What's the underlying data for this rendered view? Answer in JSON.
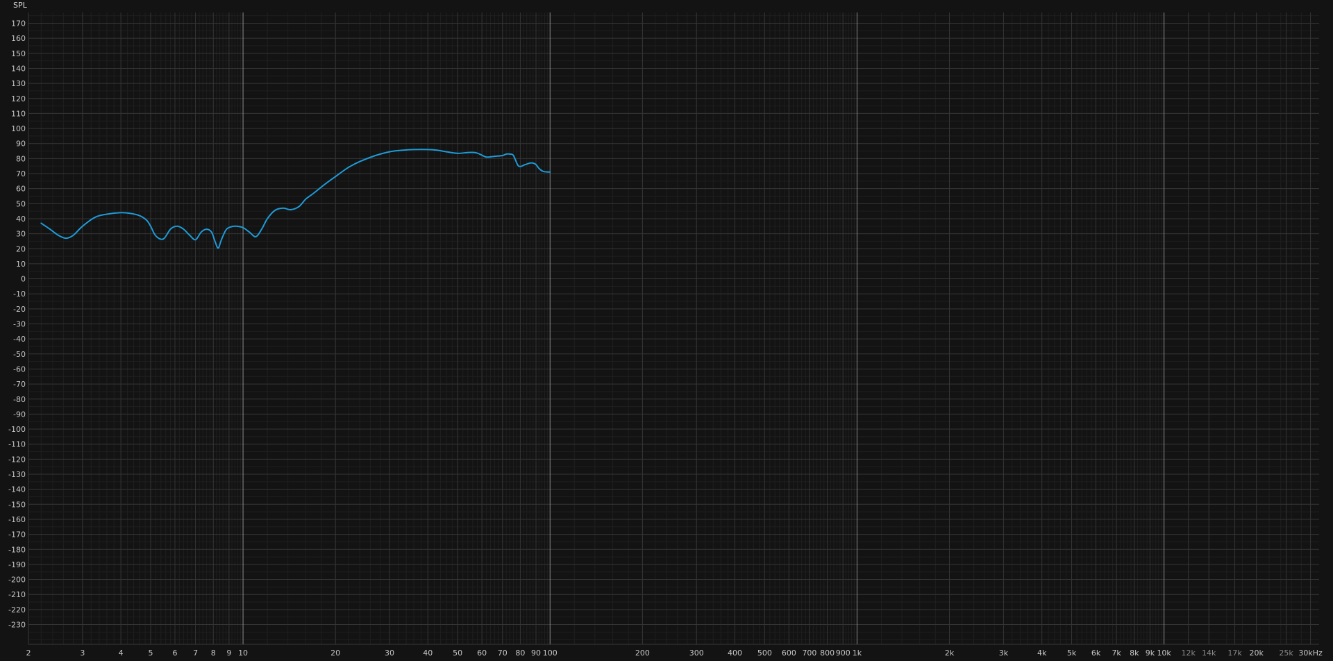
{
  "chart_data": {
    "type": "line",
    "title": "",
    "ylabel": "SPL",
    "xlabel": "",
    "x_scale": "log",
    "xlim": [
      2,
      32000
    ],
    "ylim": [
      -240,
      178
    ],
    "grid": true,
    "legend": "none",
    "y_ticks": [
      170,
      160,
      150,
      140,
      130,
      120,
      110,
      100,
      90,
      80,
      70,
      60,
      50,
      40,
      30,
      20,
      10,
      0,
      -10,
      -20,
      -30,
      -40,
      -50,
      -60,
      -70,
      -80,
      -90,
      -100,
      -110,
      -120,
      -130,
      -140,
      -150,
      -160,
      -170,
      -180,
      -190,
      -200,
      -210,
      -220,
      -230
    ],
    "x_ticks": [
      {
        "value": 2,
        "label": "2"
      },
      {
        "value": 3,
        "label": "3"
      },
      {
        "value": 4,
        "label": "4"
      },
      {
        "value": 5,
        "label": "5"
      },
      {
        "value": 6,
        "label": "6"
      },
      {
        "value": 7,
        "label": "7"
      },
      {
        "value": 8,
        "label": "8"
      },
      {
        "value": 9,
        "label": "9"
      },
      {
        "value": 10,
        "label": "10"
      },
      {
        "value": 20,
        "label": "20"
      },
      {
        "value": 30,
        "label": "30"
      },
      {
        "value": 40,
        "label": "40"
      },
      {
        "value": 50,
        "label": "50"
      },
      {
        "value": 60,
        "label": "60"
      },
      {
        "value": 70,
        "label": "70"
      },
      {
        "value": 80,
        "label": "80"
      },
      {
        "value": 90,
        "label": "90"
      },
      {
        "value": 100,
        "label": "100"
      },
      {
        "value": 200,
        "label": "200"
      },
      {
        "value": 300,
        "label": "300"
      },
      {
        "value": 400,
        "label": "400"
      },
      {
        "value": 500,
        "label": "500"
      },
      {
        "value": 600,
        "label": "600"
      },
      {
        "value": 700,
        "label": "700"
      },
      {
        "value": 800,
        "label": "800"
      },
      {
        "value": 900,
        "label": "900"
      },
      {
        "value": 1000,
        "label": "1k"
      },
      {
        "value": 2000,
        "label": "2k"
      },
      {
        "value": 3000,
        "label": "3k"
      },
      {
        "value": 4000,
        "label": "4k"
      },
      {
        "value": 5000,
        "label": "5k"
      },
      {
        "value": 6000,
        "label": "6k"
      },
      {
        "value": 7000,
        "label": "7k"
      },
      {
        "value": 8000,
        "label": "8k"
      },
      {
        "value": 9000,
        "label": "9k"
      },
      {
        "value": 10000,
        "label": "10k"
      },
      {
        "value": 12000,
        "label": "12k",
        "dim": true
      },
      {
        "value": 14000,
        "label": "14k",
        "dim": true
      },
      {
        "value": 17000,
        "label": "17k",
        "dim": true
      },
      {
        "value": 20000,
        "label": "20k"
      },
      {
        "value": 25000,
        "label": "25k",
        "dim": true
      },
      {
        "value": 30000,
        "label": "30kHz"
      }
    ],
    "series": [
      {
        "color": "#1e9bd7",
        "x": [
          2.2,
          2.35,
          2.5,
          2.65,
          2.8,
          3,
          3.3,
          3.6,
          4,
          4.3,
          4.6,
          4.85,
          5,
          5.2,
          5.5,
          5.8,
          6.1,
          6.4,
          6.7,
          7,
          7.3,
          7.6,
          7.9,
          8.1,
          8.3,
          8.5,
          8.8,
          9.1,
          9.5,
          10,
          10.5,
          11,
          11.5,
          12,
          12.7,
          13.5,
          14.3,
          15.2,
          16,
          17,
          18.5,
          20,
          22,
          24,
          27,
          30,
          33,
          36,
          40,
          43,
          46,
          50,
          54,
          57,
          59,
          62,
          66,
          70,
          72,
          74,
          76,
          79,
          83,
          86,
          88,
          90,
          92,
          95,
          100
        ],
        "y": [
          37,
          33,
          29,
          27,
          29,
          35,
          41,
          43,
          44,
          43.5,
          42,
          39,
          35,
          28.5,
          26.5,
          33,
          35,
          33,
          29,
          26,
          31,
          33,
          31,
          25,
          20.5,
          26,
          32.5,
          34.5,
          35,
          34,
          31,
          28,
          33,
          40,
          45.5,
          47,
          46,
          48,
          53,
          57,
          63,
          68,
          74,
          78,
          82,
          84.5,
          85.5,
          86,
          86,
          85.5,
          84.5,
          83.5,
          84,
          84,
          83,
          81,
          81.5,
          82,
          83,
          83,
          82,
          75,
          76,
          77,
          77,
          76,
          73.5,
          71.5,
          71
        ]
      }
    ]
  }
}
